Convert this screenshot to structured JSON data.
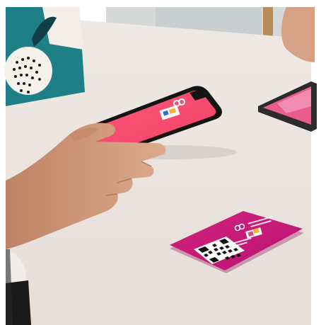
{
  "scene": {
    "palette": {
      "table": "#ece6e1",
      "wall": "#d9dad8",
      "bag_teal": "#1f7f86",
      "phone_screen": "#f2496e",
      "sign_magenta": "#c81b78",
      "skin": "#d49a7b"
    },
    "icons": [
      "phone-icon",
      "qr-code-icon",
      "tablet-icon",
      "shopping-bag-icon",
      "hand-icon"
    ]
  }
}
